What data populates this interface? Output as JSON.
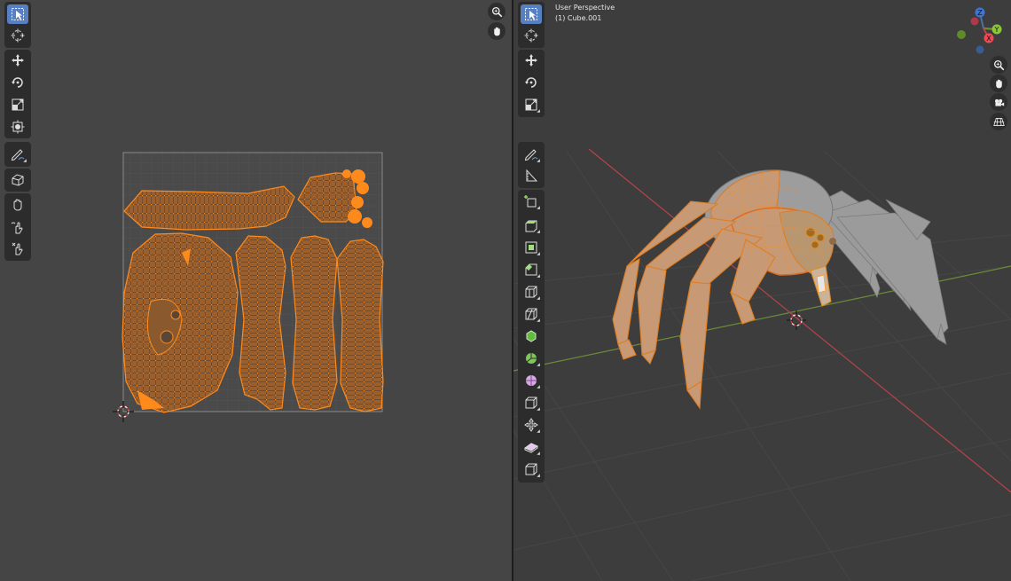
{
  "viewport": {
    "perspective_label": "User Perspective",
    "object_label": "(1) Cube.001",
    "gizmo_axes": [
      "Z",
      "Y",
      "X"
    ]
  },
  "uv_editor": {
    "tools": [
      "select-box-icon",
      "cursor-icon",
      "move-icon",
      "rotate-icon",
      "scale-icon",
      "transform-icon",
      "annotate-icon",
      "rip-region-icon",
      "grab-icon",
      "relax-icon",
      "pinch-icon"
    ],
    "nav": [
      "zoom-icon",
      "pan-icon"
    ]
  },
  "viewport_tools": [
    "select-box-icon",
    "cursor-icon",
    "move-icon",
    "rotate-icon",
    "scale-icon",
    "annotate-icon",
    "measure-icon",
    "add-cube-icon",
    "extrude-region-icon",
    "inset-faces-icon",
    "bevel-icon",
    "loop-cut-icon",
    "knife-icon",
    "poly-build-icon",
    "spin-icon",
    "smooth-icon",
    "shrink-fatten-icon",
    "shear-icon",
    "rip-region-icon"
  ],
  "viewport_nav": [
    "zoom-icon",
    "pan-icon",
    "camera-icon",
    "grid-toggle-icon"
  ],
  "colors": {
    "uv_orange": "#ff8a1c",
    "uv_face": "#9a5f2c",
    "active_tool": "#5680c2",
    "x_axis": "#b8434a",
    "y_axis": "#5f8c2a"
  }
}
